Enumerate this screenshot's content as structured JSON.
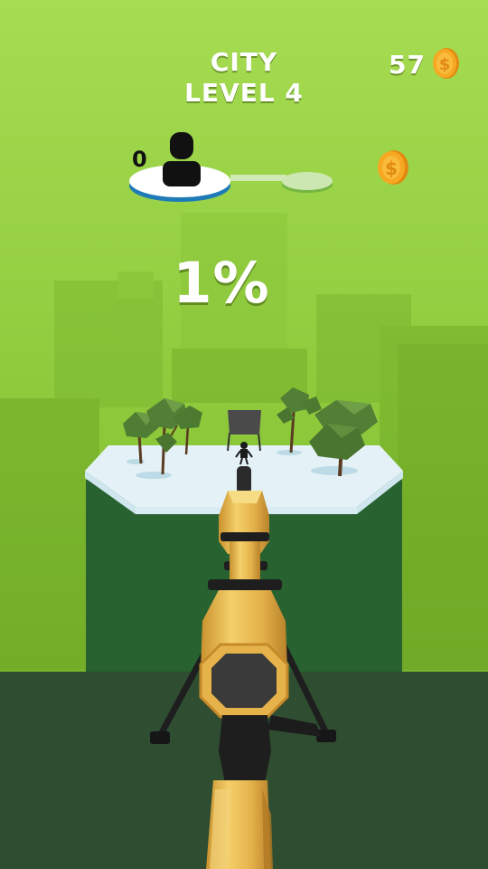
{
  "hud": {
    "location": "CITY",
    "level": "LEVEL 4",
    "coins": "57",
    "player_score": "0",
    "progress_percent": "1%"
  },
  "colors": {
    "sky_top": "#9ed54a",
    "sky_bottom": "#78b426",
    "ground": "#2e4d31",
    "platform_top": "#e3f1f6",
    "platform_side": "#2b6432",
    "rifle_gold": "#e9b84a",
    "coin_gold": "#f5a623"
  },
  "icons": {
    "coin": "dollar-coin-icon",
    "avatar": "player-silhouette-icon"
  }
}
